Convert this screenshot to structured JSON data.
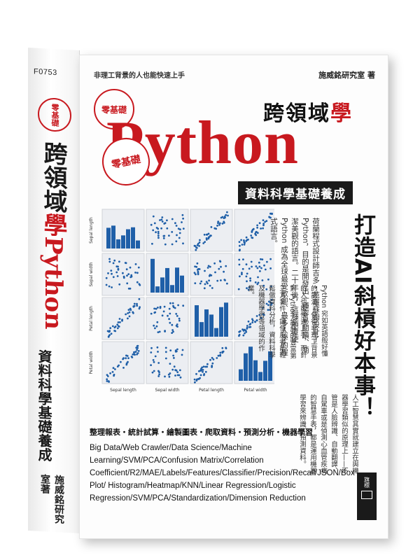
{
  "spine": {
    "code": "F0753",
    "badge": "零基礎",
    "title_prefix": "跨領域",
    "title_red": "學",
    "title_python": "Python",
    "subtitle": "資料科學基礎養成",
    "author": "施威銘研究室著"
  },
  "cover": {
    "tagline": "非理工背景的人也能快速上手",
    "author": "施威銘研究室 著",
    "seal": "零基礎",
    "cross_title_prefix": "跨領域",
    "cross_title_red": "學",
    "python": "Python",
    "zero_stamp": "零基礎",
    "subtitle": "資料科學基礎養成",
    "catch": "打造AI斜槓好本事！",
    "para1": "荷蘭程式設計師吉多・范羅蘇姆設計了 Python，目的是開發出一種容易閱讀、簡潔美觀的語言。二十年後，這種顛覆使 Python 成為全球最受歡迎、最多人學的程式語言。",
    "para2": "Python 宛如英語般好懂的語法，使得非理工背景的人也能快速上手，而針對 Python 設計的豐富第三方套件，讓使用者能輕鬆做資料分析，資料科學及機器學習等領域的作業。",
    "para3": "人工智慧其實就建立在與機器學習類似的原理上——不管是人臉辨識、自動翻譯、自駕車或是偵測心血管疾病的智慧手表，都是運用機器學習來辨識／預測資料。",
    "topics": "整理報表・統計試算・繪製圖表・爬取資料・預測分析・機器學習",
    "keywords": "Big Data/Web Crawler/Data Science/Machine Learning/SVM/PCA/Confusion Matrix/Correlation Coefficient/R2/MAE/Labels/Features/Classifier/Precision/Recall/JSON/Box Plot/ Histogram/Heatmap/KNN/Linear Regression/Logistic Regression/SVM/PCA/Standardization/Dimension Reduction",
    "publisher": "旗標"
  },
  "pairplot": {
    "variables": [
      "Sepal length",
      "Sepal width",
      "Petal length",
      "Petal width"
    ],
    "color": "#1f5fa8"
  },
  "colors": {
    "accent": "#c8191f",
    "dark": "#1a1a1a"
  }
}
